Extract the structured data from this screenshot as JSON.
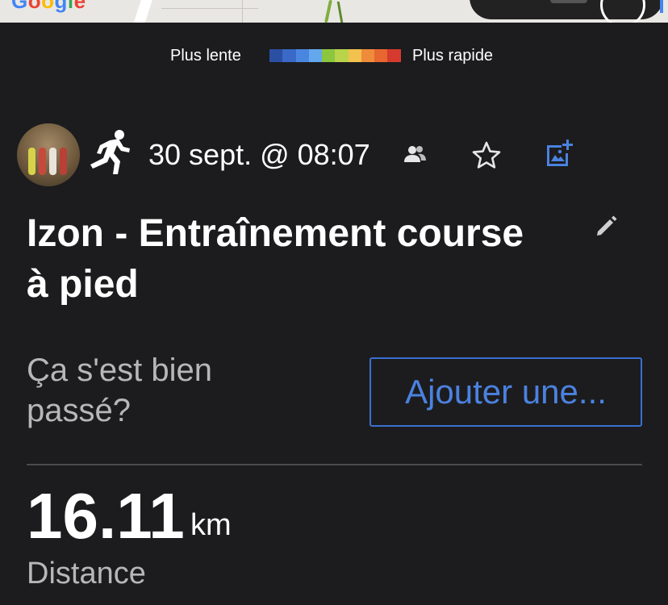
{
  "map": {
    "logo_letters": [
      "G",
      "o",
      "o",
      "g",
      "l",
      "e"
    ]
  },
  "pace_legend": {
    "slow_label": "Plus lente",
    "fast_label": "Plus rapide",
    "colors": [
      "#2b4fa3",
      "#3a69c7",
      "#4a86e0",
      "#63a8ec",
      "#8cc63f",
      "#b9d34a",
      "#f2c14e",
      "#ef8c3a",
      "#e8662f",
      "#d63a2e"
    ]
  },
  "activity": {
    "avatar_icon": "avatar",
    "type_icon": "running-icon",
    "date": "30 sept. @ 08:07",
    "title": "Izon - Entraînement course à pied",
    "feedback_question": "Ça s'est bien passé?",
    "add_button_label": "Ajouter une..."
  },
  "stats": {
    "distance_value": "16.11",
    "distance_unit": "km",
    "distance_label": "Distance"
  },
  "colors": {
    "background": "#1c1c1e",
    "accent": "#4b82e0",
    "muted_text": "#b7b7b9"
  }
}
